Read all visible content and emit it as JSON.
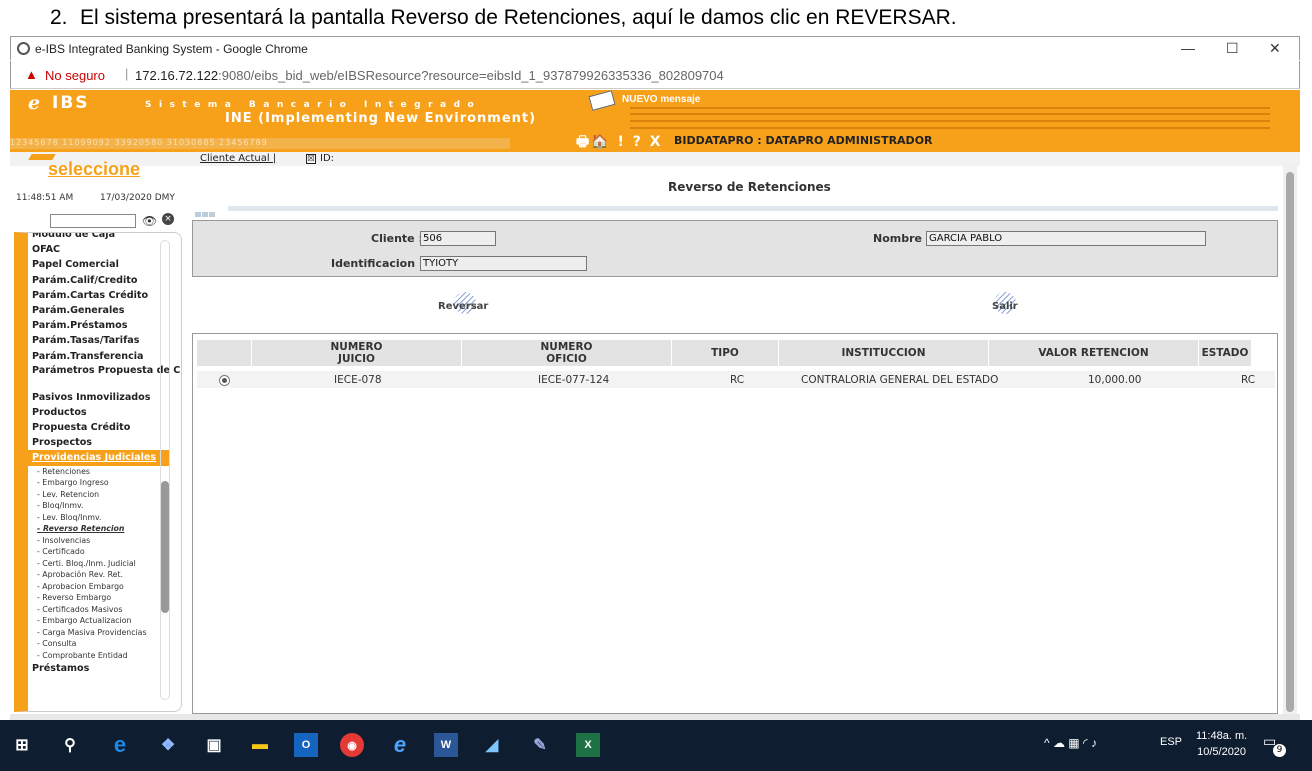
{
  "caption": {
    "number": "2.",
    "text": "El sistema presentará la pantalla Reverso de Retenciones, aquí le damos clic en REVERSAR."
  },
  "browser": {
    "title": "e-IBS Integrated Banking System - Google Chrome",
    "minimize": "—",
    "maximize": "☐",
    "close": "✕",
    "security_label": "No seguro",
    "url_host": "172.16.72.122",
    "url_path": ":9080/eibs_bid_web/eIBSResource?resource=eibsId_1_937879926335336_802809704"
  },
  "header": {
    "logo_e": "e",
    "logo_ibs": "IBS",
    "sistema": "Sistema Bancario Integrado",
    "ine": "INE (Implementing New Environment)",
    "number_strip": "12345678   11099092   33920580   31030885   23456789",
    "message": "NUEVO mensaje",
    "toolbar_icons": "🖶🏠 ! ? X",
    "user": "BIDDATAPRO : DATAPRO ADMINISTRADOR"
  },
  "infobar": {
    "cliente_actual": "Cliente Actual |",
    "id_label": "ID:",
    "checkbox_mark": "☒"
  },
  "left": {
    "seleccione": "seleccione",
    "time": "11:48:51 AM",
    "date": "17/03/2020 DMY",
    "menu_top": "Módulo de Caja",
    "menu_items": [
      "OFAC",
      "Papel Comercial",
      "Parám.Calif/Credito",
      "Parám.Cartas Crédito",
      "Parám.Generales",
      "Parám.Préstamos",
      "Parám.Tasas/Tarifas",
      "Parám.Transferencia"
    ],
    "menu_two_line": "Parámetros Propuesta de Credito",
    "menu_items2": [
      "Pasivos Inmovilizados",
      "Productos",
      "Propuesta Crédito",
      "Prospectos"
    ],
    "menu_active": "Providencias Judiciales",
    "sub_items": [
      "- Retenciones",
      "- Embargo Ingreso",
      "- Lev. Retencion",
      "- Bloq/Inmv.",
      "- Lev. Bloq/Inmv."
    ],
    "sub_current": "- Reverso Retencion",
    "sub_items2": [
      "- Insolvencias",
      "- Certificado",
      "- Certi. Bloq./Inm. Judicial",
      "- Aprobación Rev. Ret.",
      "- Aprobacion Embargo",
      "- Reverso Embargo",
      "- Certificados Masivos",
      "- Embargo Actualizacion",
      "- Carga Masiva Providencias",
      "- Consulta",
      "- Comprobante Entidad"
    ],
    "menu_last": "Préstamos"
  },
  "main": {
    "title": "Reverso de Retenciones",
    "cliente_label": "Cliente :",
    "cliente_value": "506",
    "nombre_label": "Nombre :",
    "nombre_value": "GARCIA  PABLO",
    "ident_label": "Identificacion :",
    "ident_value": "TYIOTY",
    "reversar": "Reversar",
    "salir": "Salir",
    "columns": {
      "juicio": "NUMERO\nJUICIO",
      "oficio": "NUMERO\nOFICIO",
      "tipo": "TIPO",
      "institucion": "INSTITUCCION",
      "valor": "VALOR RETENCION",
      "estado": "ESTADO"
    },
    "row": {
      "juicio": "IECE-078",
      "oficio": "IECE-077-124",
      "tipo": "RC",
      "institucion": "CONTRALORIA GENERAL DEL ESTADO",
      "valor": "10,000.00",
      "estado": "RC"
    }
  },
  "taskbar": {
    "apps": [
      "windows-start",
      "search",
      "edge",
      "dropbox",
      "store",
      "file-explorer",
      "outlook",
      "chrome",
      "internet-explorer",
      "word",
      "app-blue",
      "paint",
      "excel"
    ],
    "tray_lang": "ESP",
    "time": "11:48a. m.",
    "date": "10/5/2020",
    "notif_count": "9"
  },
  "colors": {
    "accent": "#f7a11a",
    "taskbar": "#0e1d2f"
  }
}
